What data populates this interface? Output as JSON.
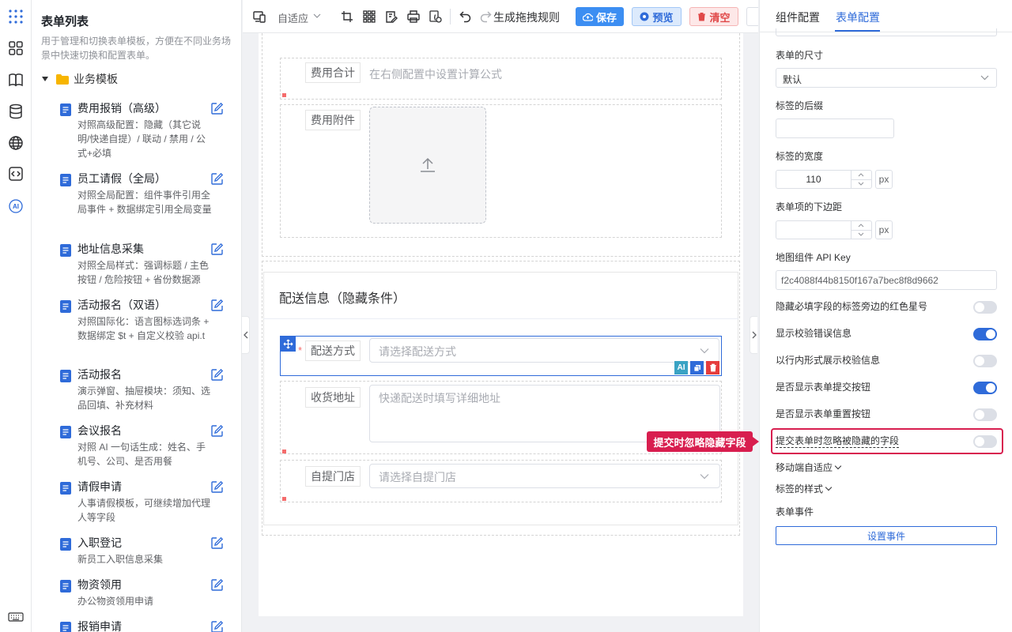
{
  "sidebar": {
    "title": "表单列表",
    "description": "用于管理和切换表单模板，方便在不同业务场景中快速切换和配置表单。",
    "group": "业务模板",
    "templates": [
      {
        "name": "费用报销（高级）",
        "desc": "对照高级配置：隐藏（其它说明/快递自提）/ 联动 / 禁用 / 公式+必填"
      },
      {
        "name": "员工请假（全局）",
        "desc": "对照全局配置：组件事件引用全局事件 + 数据绑定引用全局变量"
      },
      {
        "name": "地址信息采集",
        "desc": "对照全局样式：强调标题 / 主色按钮 / 危险按钮 + 省份数据源"
      },
      {
        "name": "活动报名（双语）",
        "desc": "对照国际化：语言图标选词条 + 数据绑定 $t + 自定义校验 api.t"
      },
      {
        "name": "活动报名",
        "desc": "演示弹窗、抽屉模块：须知、选品回填、补充材料"
      },
      {
        "name": "会议报名",
        "desc": "对照 AI 一句话生成：姓名、手机号、公司、是否用餐"
      },
      {
        "name": "请假申请",
        "desc": "人事请假模板，可继续增加代理人等字段"
      },
      {
        "name": "入职登记",
        "desc": "新员工入职信息采集"
      },
      {
        "name": "物资领用",
        "desc": "办公物资领用申请"
      },
      {
        "name": "报销申请",
        "desc": ""
      }
    ]
  },
  "toolbar": {
    "adapt": "自适应",
    "generate_rules": "生成拖拽规则",
    "save": "保存",
    "preview": "预览",
    "clear": "清空"
  },
  "canvas": {
    "cost_total_label": "费用合计",
    "cost_total_hint": "在右侧配置中设置计算公式",
    "attachment_label": "费用附件",
    "section_title": "配送信息（隐藏条件）",
    "delivery_label": "配送方式",
    "delivery_placeholder": "请选择配送方式",
    "address_label": "收货地址",
    "address_placeholder": "快递配送时填写详细地址",
    "store_label": "自提门店",
    "store_placeholder": "请选择自提门店",
    "required_mark": "*",
    "ai_badge": "AI"
  },
  "panel": {
    "tab_component": "组件配置",
    "tab_form": "表单配置",
    "size_label": "表单的尺寸",
    "size_value": "默认",
    "suffix_label": "标签的后缀",
    "suffix_value": "",
    "width_label": "标签的宽度",
    "width_value": "110",
    "unit": "px",
    "margin_label": "表单项的下边距",
    "margin_value": "",
    "map_key_label": "地图组件 API Key",
    "map_key_value": "f2c4088f44b8150f167a7bec8f8d9662",
    "toggles": [
      {
        "label": "隐藏必填字段的标签旁边的红色星号",
        "on": false
      },
      {
        "label": "显示校验错误信息",
        "on": true
      },
      {
        "label": "以行内形式展示校验信息",
        "on": false
      },
      {
        "label": "是否显示表单提交按钮",
        "on": true
      },
      {
        "label": "是否显示表单重置按钮",
        "on": false
      },
      {
        "label": "提交表单时忽略被隐藏的字段",
        "on": false
      }
    ],
    "mobile_label": "移动端自适应",
    "label_style": "标签的样式",
    "events_label": "表单事件",
    "events_button": "设置事件",
    "callout": "提交时忽略隐藏字段"
  },
  "colors": {
    "accent": "#2f6bd9",
    "highlight": "#d81e4f",
    "danger": "#f56c6c",
    "switch_on": "#2f6bd9",
    "switch_off": "#dcdfe6"
  }
}
